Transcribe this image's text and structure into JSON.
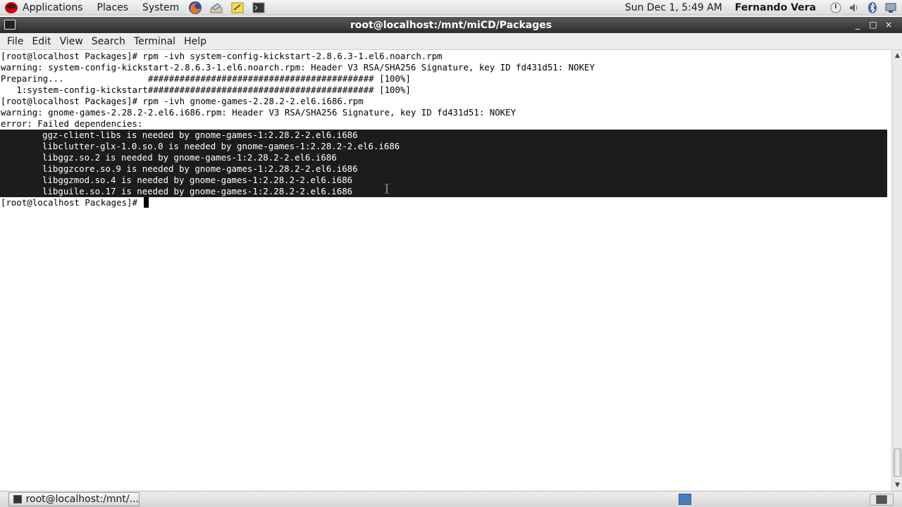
{
  "top_panel": {
    "menus": [
      "Applications",
      "Places",
      "System"
    ],
    "clock": "Sun Dec  1,  5:49 AM",
    "user": "Fernando Vera"
  },
  "window": {
    "title": "root@localhost:/mnt/miCD/Packages",
    "controls": [
      "_",
      "□",
      "×"
    ]
  },
  "menubar": {
    "items": [
      "File",
      "Edit",
      "View",
      "Search",
      "Terminal",
      "Help"
    ]
  },
  "terminal": {
    "lines": [
      "[root@localhost Packages]# rpm -ivh system-config-kickstart-2.8.6.3-1.el6.noarch.rpm",
      "warning: system-config-kickstart-2.8.6.3-1.el6.noarch.rpm: Header V3 RSA/SHA256 Signature, key ID fd431d51: NOKEY",
      "Preparing...                ########################################### [100%]",
      "   1:system-config-kickstart########################################### [100%]",
      "[root@localhost Packages]# rpm -ivh gnome-games-2.28.2-2.el6.i686.rpm",
      "warning: gnome-games-2.28.2-2.el6.i686.rpm: Header V3 RSA/SHA256 Signature, key ID fd431d51: NOKEY",
      "error: Failed dependencies:"
    ],
    "selected_lines": [
      "ggz-client-libs is needed by gnome-games-1:2.28.2-2.el6.i686",
      "libclutter-glx-1.0.so.0 is needed by gnome-games-1:2.28.2-2.el6.i686",
      "libggz.so.2 is needed by gnome-games-1:2.28.2-2.el6.i686",
      "libggzcore.so.9 is needed by gnome-games-1:2.28.2-2.el6.i686",
      "libggzmod.so.4 is needed by gnome-games-1:2.28.2-2.el6.i686",
      "libguile.so.17 is needed by gnome-games-1:2.28.2-2.el6.i686"
    ],
    "prompt": "[root@localhost Packages]# "
  },
  "taskbar": {
    "task_label": "root@localhost:/mnt/..."
  }
}
